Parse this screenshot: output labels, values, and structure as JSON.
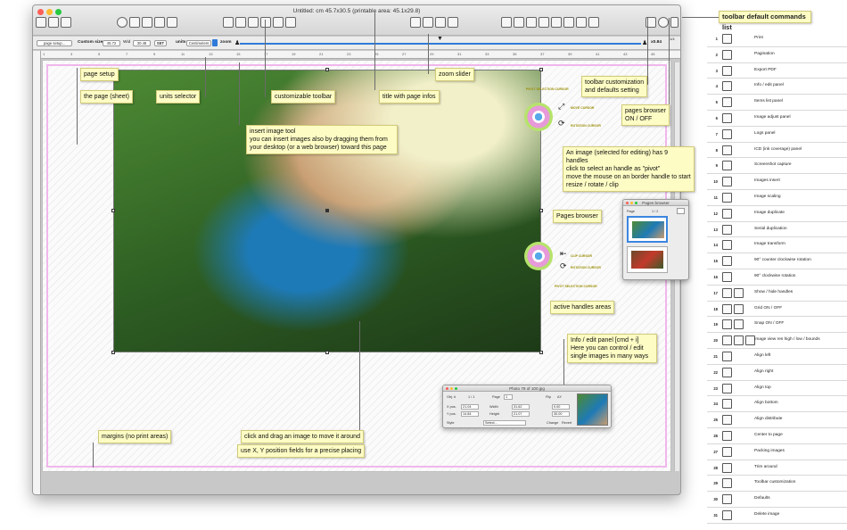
{
  "window": {
    "title": "Untitled: cm  45.7x30.5 (printable area: 45.1x29.8)"
  },
  "toolbar_strip": {
    "page_setup_label": "page setup...",
    "custom_size_label": "Custom size:",
    "size_w": "45.72",
    "wid_label": "Wid",
    "size_h": "30.48",
    "set_label": "SET",
    "units_label": "units:",
    "units_value": "Centimeters",
    "zoom_label": "zoom",
    "zoom_value": "x0.84",
    "corner_label": "1/4"
  },
  "ruler": {
    "ticks": [
      "1",
      "3",
      "5",
      "7",
      "9",
      "11",
      "13",
      "15",
      "17",
      "19",
      "21",
      "23",
      "25",
      "27",
      "29",
      "31",
      "33",
      "35",
      "37",
      "39",
      "41",
      "43",
      "45"
    ]
  },
  "callouts": {
    "page_setup": "page setup",
    "the_page": "the page (sheet)",
    "units_selector": "units selector",
    "customizable_toolbar": "customizable toolbar",
    "title_infos": "title with page infos",
    "zoom_slider": "zoom slider",
    "toolbar_custom": "toolbar customization\nand defaults setting",
    "pages_browser_onoff": "pages browser\nON / OFF",
    "insert_tool": "insert image tool\nyou can insert images also by dragging them from\nyour desktop (or a web browser) toward this page",
    "handles": "An image (selected for editing) has 9 handles\nclick to select an handle as \"pivot\"\nmove the mouse on an border handle to start\nresize / rotate / clip",
    "pages_browser": "Pages browser",
    "active_handles": "active handles areas",
    "info_panel": "Info / edit panel [cmd + i]\nHere you can control / edit\nsingle images in many ways",
    "margins": "margins (no print areas)",
    "drag": "click and drag an image to move it around",
    "xy": "use X, Y position fields for a precise placing"
  },
  "cursor_labels": {
    "pivot_top": "PIVOT SELECTION CURSOR",
    "move": "MOVE CURSOR",
    "rotation_top": "ROTATION CURSOR",
    "clip": "CLIP CURSOR",
    "rotation_bottom": "ROTATION CURSOR",
    "pivot_bottom": "PIVOT SELECTION CURSOR"
  },
  "pages_browser_panel": {
    "title": "Pages browser",
    "page_label": "Page",
    "page_value": "1 / 2"
  },
  "info_panel": {
    "title": "Photo 79 of 100.jpg",
    "obj_label": "Obj. #",
    "obj_value": "1 / 1",
    "page_label": "Page",
    "page_value": "1",
    "flip_label": "Flip",
    "flip_value": "ΔY",
    "xpos_label": "X pos.",
    "xpos_value": "21.04",
    "ypos_label": "Y pos.",
    "ypos_value": "14.84",
    "width_label": "Width",
    "width_value": "31.62",
    "height_label": "Height",
    "height_value": "21.07",
    "rot_value": "0.00",
    "scale_value": "30.00",
    "style_label": "Style",
    "style_value": "Select...",
    "change_label": "Change",
    "revert_label": "Revert"
  },
  "command_list": {
    "title": "toolbar default commands list",
    "items": [
      {
        "n": "1",
        "label": "Print",
        "icons": 1
      },
      {
        "n": "2",
        "label": "Pagination",
        "icons": 1
      },
      {
        "n": "3",
        "label": "Export PDF",
        "icons": 1
      },
      {
        "n": "4",
        "label": "Info / edit panel",
        "icons": 1
      },
      {
        "n": "5",
        "label": "Items list panel",
        "icons": 1
      },
      {
        "n": "6",
        "label": "Image adjust panel",
        "icons": 1
      },
      {
        "n": "7",
        "label": "Logs panel",
        "icons": 1
      },
      {
        "n": "8",
        "label": "ICD (ink coverage) panel",
        "icons": 1
      },
      {
        "n": "9",
        "label": "Screenshot capture",
        "icons": 1
      },
      {
        "n": "10",
        "label": "Images insert",
        "icons": 1
      },
      {
        "n": "11",
        "label": "Image scaling",
        "icons": 1
      },
      {
        "n": "12",
        "label": "Image duplicate",
        "icons": 1
      },
      {
        "n": "13",
        "label": "Serial duplication",
        "icons": 1
      },
      {
        "n": "14",
        "label": "Image transform",
        "icons": 1
      },
      {
        "n": "15",
        "label": "90° counter clockwise rotation",
        "icons": 1
      },
      {
        "n": "16",
        "label": "90° clockwise rotation",
        "icons": 1
      },
      {
        "n": "17",
        "label": "Show / hide handles",
        "icons": 2
      },
      {
        "n": "18",
        "label": "Grid ON / OFF",
        "icons": 2
      },
      {
        "n": "19",
        "label": "Snap ON / OFF",
        "icons": 2
      },
      {
        "n": "20",
        "label": "Image view res high / low / bounds",
        "icons": 3
      },
      {
        "n": "21",
        "label": "Align left",
        "icons": 1
      },
      {
        "n": "22",
        "label": "Align right",
        "icons": 1
      },
      {
        "n": "23",
        "label": "Align top",
        "icons": 1
      },
      {
        "n": "24",
        "label": "Align bottom",
        "icons": 1
      },
      {
        "n": "25",
        "label": "Align distribute",
        "icons": 1
      },
      {
        "n": "26",
        "label": "Center to page",
        "icons": 1
      },
      {
        "n": "27",
        "label": "Packing images",
        "icons": 1
      },
      {
        "n": "28",
        "label": "Trim around",
        "icons": 1
      },
      {
        "n": "29",
        "label": "Toolbar customization",
        "icons": 1
      },
      {
        "n": "30",
        "label": "Defaults",
        "icons": 1
      },
      {
        "n": "31",
        "label": "Delete image",
        "icons": 1
      }
    ]
  },
  "colors": {
    "accent_blue": "#2f7bd8",
    "margin_pink": "#f0b7ec",
    "note_yellow": "#fdfcc4"
  }
}
